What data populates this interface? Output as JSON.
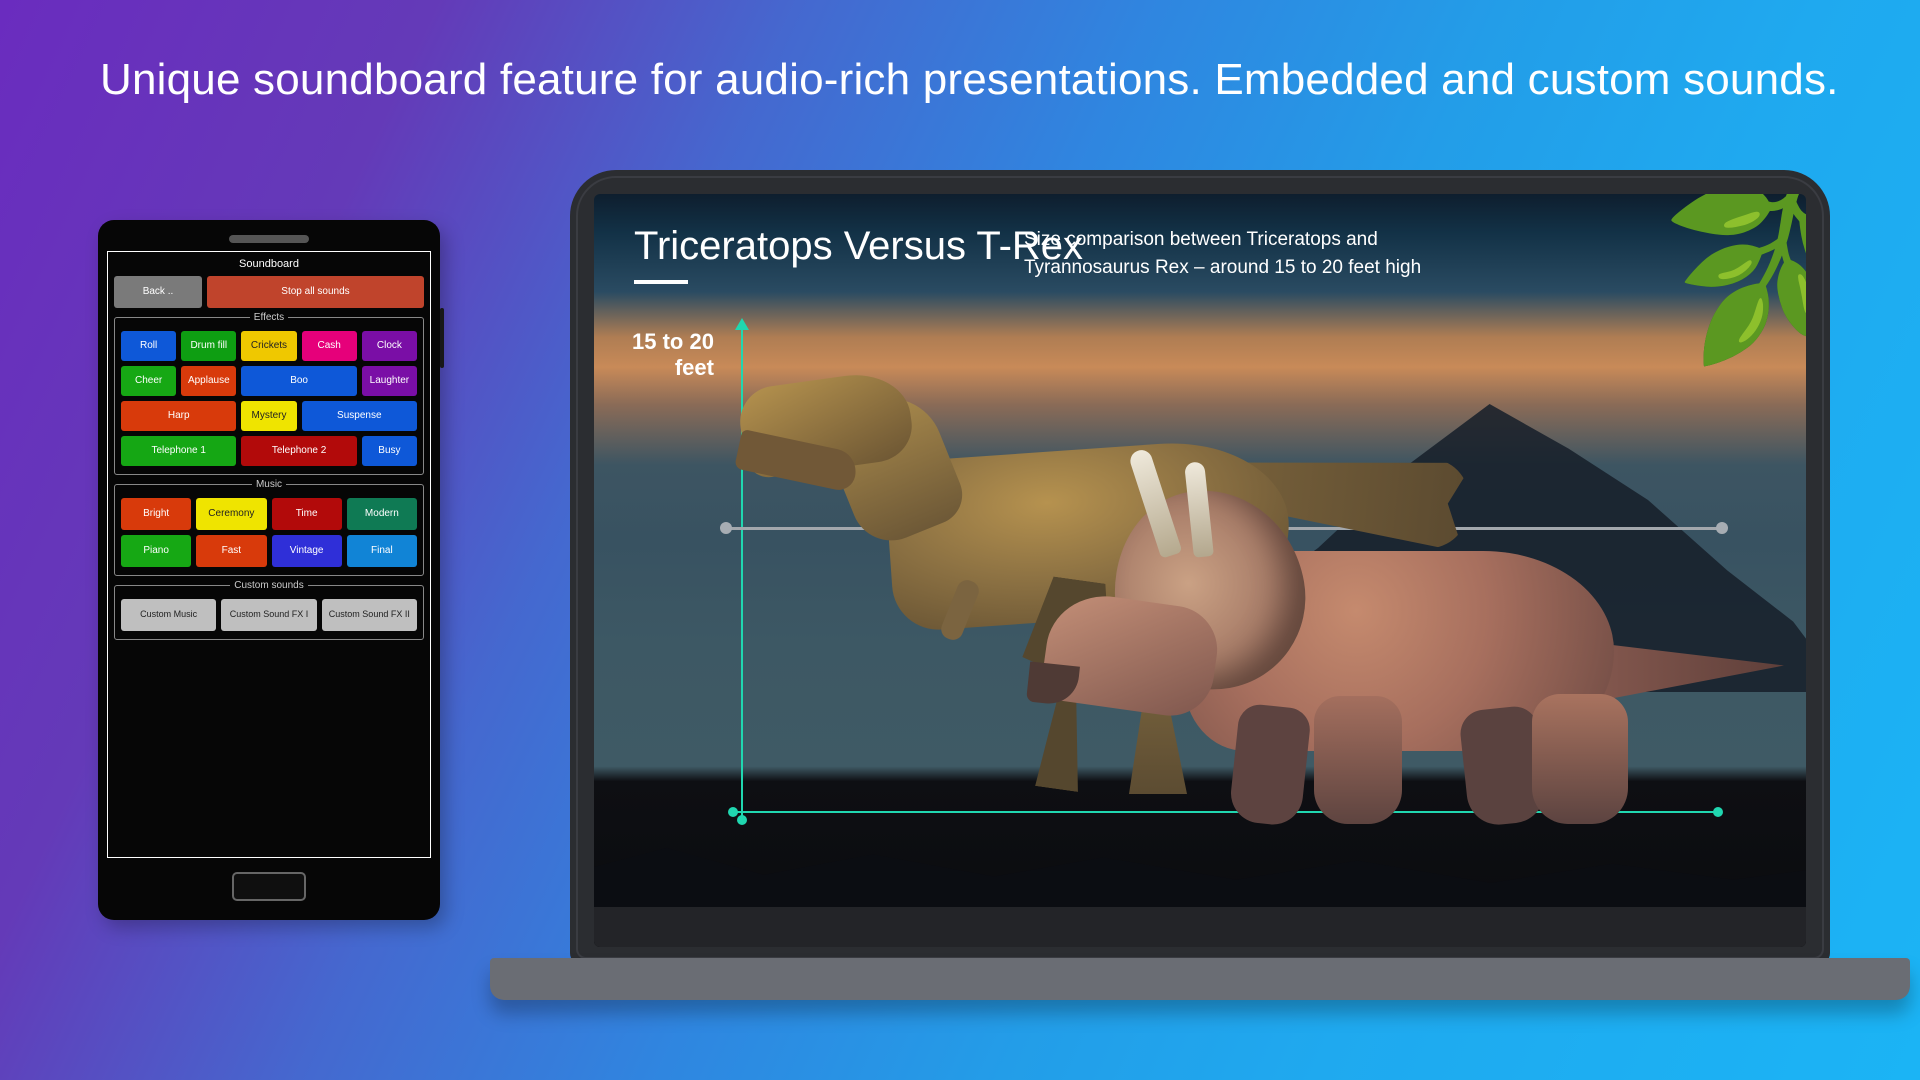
{
  "headline": "Unique soundboard feature for audio-rich presentations. Embedded and custom sounds.",
  "phone": {
    "title": "Soundboard",
    "back_label": "Back ..",
    "stop_label": "Stop all sounds",
    "groups": {
      "effects": {
        "legend": "Effects",
        "items": [
          {
            "label": "Roll",
            "bg": "#0e58d8"
          },
          {
            "label": "Drum fill",
            "bg": "#0e9e12"
          },
          {
            "label": "Crickets",
            "bg": "#efc800"
          },
          {
            "label": "Cash",
            "bg": "#e6007a"
          },
          {
            "label": "Clock",
            "bg": "#7a0ea6"
          },
          {
            "label": "Cheer",
            "bg": "#16a814"
          },
          {
            "label": "Applause",
            "bg": "#d83a0b"
          },
          {
            "label": "Boo",
            "bg": "#0e58d8",
            "span": 2
          },
          {
            "label": "Laughter",
            "bg": "#7a0ea6"
          },
          {
            "label": "Harp",
            "bg": "#d83a0b",
            "span": 2
          },
          {
            "label": "Mystery",
            "bg": "#efe400"
          },
          {
            "label": "Suspense",
            "bg": "#0e58d8",
            "span": 2
          },
          {
            "label": "Telephone 1",
            "bg": "#15a714",
            "span": 2
          },
          {
            "label": "Telephone 2",
            "bg": "#b20a0a",
            "span": 2
          },
          {
            "label": "Busy",
            "bg": "#0e58d8"
          }
        ]
      },
      "music": {
        "legend": "Music",
        "items": [
          {
            "label": "Bright",
            "bg": "#d83a0b"
          },
          {
            "label": "Ceremony",
            "bg": "#efe400"
          },
          {
            "label": "Time",
            "bg": "#b20a0a"
          },
          {
            "label": "Modern",
            "bg": "#0f7a54"
          },
          {
            "label": "Piano",
            "bg": "#16a814"
          },
          {
            "label": "Fast",
            "bg": "#d83a0b"
          },
          {
            "label": "Vintage",
            "bg": "#2f2fd8"
          },
          {
            "label": "Final",
            "bg": "#1184d6"
          }
        ]
      },
      "custom": {
        "legend": "Custom sounds",
        "items": [
          {
            "label": "Custom Music",
            "bg": "#bfbfbf"
          },
          {
            "label": "Custom Sound FX I",
            "bg": "#bfbfbf"
          },
          {
            "label": "Custom Sound FX II",
            "bg": "#bfbfbf"
          }
        ]
      }
    }
  },
  "slide": {
    "title": "Triceratops Versus T-Rex",
    "description": "Size comparison between Triceratops and Tyrannosaurus Rex – around 15 to 20 feet high",
    "height_label_l1": "15 to 20",
    "height_label_l2": "feet"
  }
}
